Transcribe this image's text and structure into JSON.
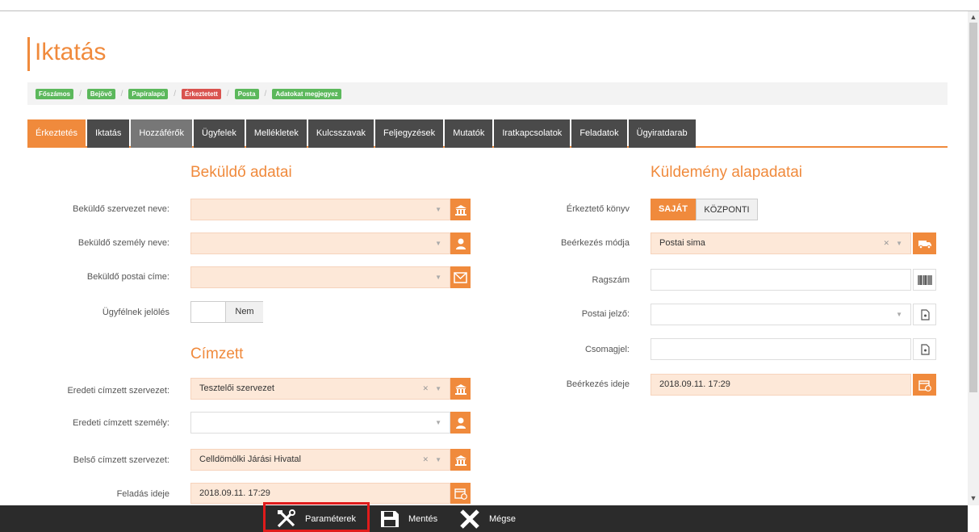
{
  "page_title": "Iktatás",
  "breadcrumb": [
    "Főszámos",
    "Bejövő",
    "Papíralapú",
    "Érkeztetett",
    "Posta",
    "Adatokat megjegyez"
  ],
  "tabs": [
    "Érkeztetés",
    "Iktatás",
    "Hozzáférők",
    "Ügyfelek",
    "Mellékletek",
    "Kulcsszavak",
    "Feljegyzések",
    "Mutatók",
    "Iratkapcsolatok",
    "Feladatok",
    "Ügyiratdarab"
  ],
  "left": {
    "section1": "Beküldő adatai",
    "sender_org_label": "Beküldő szervezet neve:",
    "sender_person_label": "Beküldő személy neve:",
    "sender_address_label": "Beküldő postai címe:",
    "client_mark_label": "Ügyfélnek jelölés",
    "client_mark_value": "Nem",
    "section2": "Címzett",
    "orig_org_label": "Eredeti címzett szervezet:",
    "orig_org_value": "Tesztelői szervezet",
    "orig_person_label": "Eredeti címzett személy:",
    "internal_org_label": "Belső címzett szervezet:",
    "internal_org_value": "Celldömölki Járási Hivatal",
    "send_time_label": "Feladás ideje",
    "send_time_value": "2018.09.11. 17:29"
  },
  "right": {
    "section": "Küldemény alapadatai",
    "book_label": "Érkeztető könyv",
    "book_own": "SAJÁT",
    "book_central": "KÖZPONTI",
    "arrival_mode_label": "Beérkezés módja",
    "arrival_mode_value": "Postai sima",
    "tag_label": "Ragszám",
    "postal_mark_label": "Postai jelző:",
    "package_label": "Csomagjel:",
    "arrival_time_label": "Beérkezés ideje",
    "arrival_time_value": "2018.09.11. 17:29"
  },
  "bottombar": {
    "params": "Paraméterek",
    "save": "Mentés",
    "cancel": "Mégse"
  },
  "colors": {
    "accent": "#f08a3c",
    "dark": "#2b2b2b",
    "green": "#5cb85c",
    "red": "#d9534f",
    "highlight": "#e01b1b"
  }
}
